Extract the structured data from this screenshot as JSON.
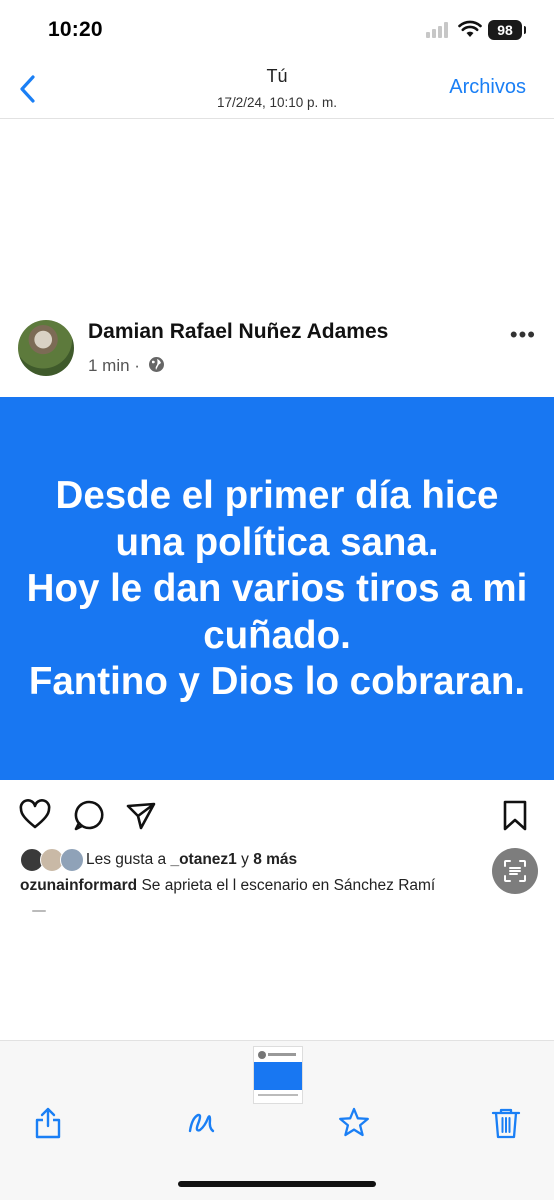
{
  "status_bar": {
    "time": "10:20",
    "battery": "98"
  },
  "nav": {
    "back_icon": "chevron-left-icon",
    "title": "Tú",
    "subtitle": "17/2/24, 10:10 p. m.",
    "archivos": "Archivos"
  },
  "post": {
    "author": "Damian Rafael Nuñez Adames",
    "meta": "1 min ·",
    "card_text": "Desde el primer día hice una política sana.\nHoy le dan varios tiros a mi cuñado.\nFantino y Dios lo cobraran.",
    "card_color": "#1877f2"
  },
  "actions": [
    "heart-icon",
    "comment-icon",
    "share-send-icon",
    "bookmark-icon"
  ],
  "likes": {
    "prefix": "Les gusta a",
    "user": "_otanez1",
    "joiner": "y",
    "more": "8 más"
  },
  "caption": {
    "user": "ozunainformard",
    "text": "Se aprieta el l escenario en Sánchez Ramí"
  },
  "toolbar": {
    "icons": [
      "share-icon",
      "markup-icon",
      "favorite-star-icon",
      "trash-icon"
    ]
  },
  "colors": {
    "accent": "#1a7ff5"
  }
}
